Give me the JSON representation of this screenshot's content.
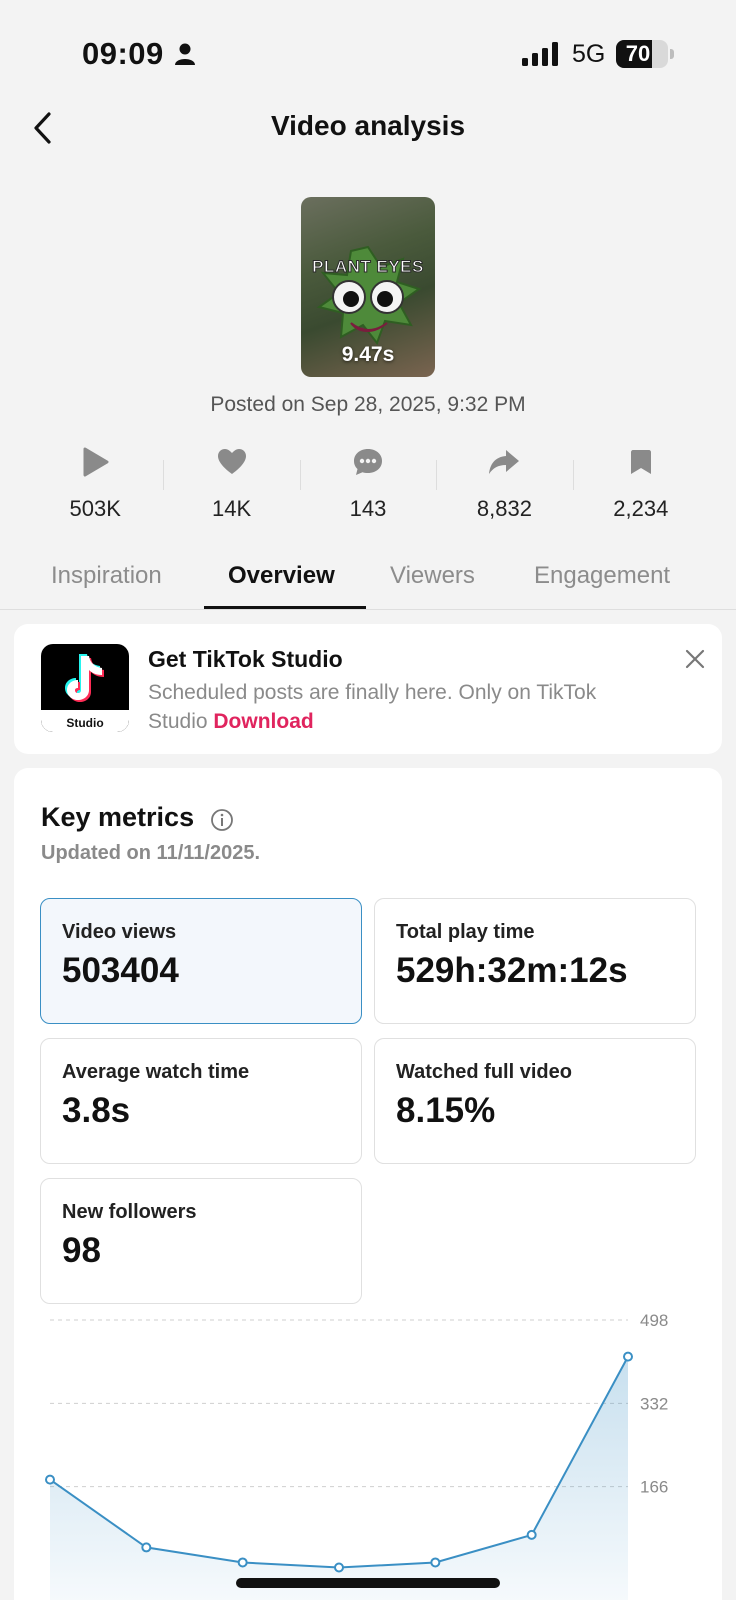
{
  "status_bar": {
    "time": "09:09",
    "network": "5G",
    "battery": "70",
    "battery_level": 0.7
  },
  "header": {
    "title": "Video analysis"
  },
  "video": {
    "thumbnail_caption": "PLANT EYES",
    "duration": "9.47s",
    "posted_on": "Posted on Sep 28, 2025, 9:32 PM"
  },
  "stats": [
    {
      "icon": "play-icon",
      "value": "503K"
    },
    {
      "icon": "heart-icon",
      "value": "14K"
    },
    {
      "icon": "comment-icon",
      "value": "143"
    },
    {
      "icon": "share-icon",
      "value": "8,832"
    },
    {
      "icon": "bookmark-icon",
      "value": "2,234"
    }
  ],
  "tabs": [
    {
      "label": "Inspiration",
      "active": false
    },
    {
      "label": "Overview",
      "active": true
    },
    {
      "label": "Viewers",
      "active": false
    },
    {
      "label": "Engagement",
      "active": false
    }
  ],
  "promo": {
    "title": "Get TikTok Studio",
    "text": "Scheduled posts are finally here. Only on TikTok Studio",
    "link": "Download",
    "logo_label": "Studio"
  },
  "key_metrics": {
    "title": "Key metrics",
    "updated": "Updated on 11/11/2025.",
    "items": [
      {
        "label": "Video views",
        "value": "503404",
        "selected": true
      },
      {
        "label": "Total play time",
        "value": "529h:32m:12s",
        "selected": false
      },
      {
        "label": "Average watch time",
        "value": "3.8s",
        "selected": false
      },
      {
        "label": "Watched full video",
        "value": "8.15%",
        "selected": false
      },
      {
        "label": "New followers",
        "value": "98",
        "selected": false
      }
    ]
  },
  "chart_data": {
    "type": "area",
    "y_ticks": [
      498,
      332,
      166
    ],
    "ylim": [
      0,
      498
    ],
    "values": [
      180,
      45,
      15,
      5,
      15,
      70,
      425
    ],
    "grid": true,
    "color": "#3a8fc4"
  }
}
